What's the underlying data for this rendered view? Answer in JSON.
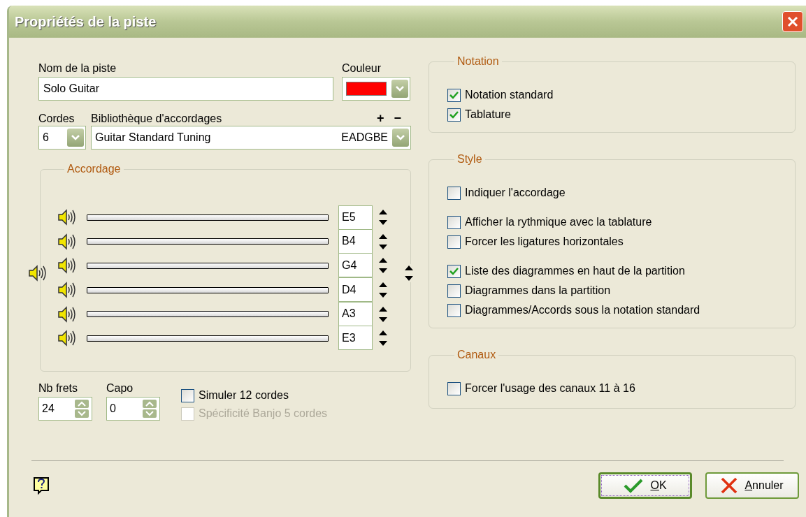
{
  "window": {
    "title": "Propriétés de la piste"
  },
  "track_name": {
    "label": "Nom de la piste",
    "value": "Solo Guitar"
  },
  "track_color": {
    "label": "Couleur",
    "color": "#ff0000"
  },
  "string_count": {
    "label": "Cordes",
    "value": "6"
  },
  "tuning_library": {
    "label": "Bibliothèque d'accordages",
    "add": "+",
    "remove": "−",
    "value": "Guitar Standard Tuning",
    "notes": "EADGBE"
  },
  "tuning": {
    "title": "Accordage",
    "strings": [
      {
        "note": "E5"
      },
      {
        "note": "B4"
      },
      {
        "note": "G4"
      },
      {
        "note": "D4"
      },
      {
        "note": "A3"
      },
      {
        "note": "E3"
      }
    ]
  },
  "frets": {
    "label": "Nb frets",
    "value": "24"
  },
  "capo": {
    "label": "Capo",
    "value": "0"
  },
  "options": [
    {
      "label": "Simuler 12 cordes",
      "checked": false,
      "disabled": false
    },
    {
      "label": "Spécificité Banjo 5 cordes",
      "checked": false,
      "disabled": true
    }
  ],
  "groups": [
    {
      "title": "Notation",
      "sections": [
        [
          {
            "label": "Notation standard",
            "checked": true
          },
          {
            "label": "Tablature",
            "checked": true
          }
        ]
      ]
    },
    {
      "title": "Style",
      "sections": [
        [
          {
            "label": "Indiquer l'accordage",
            "checked": false
          }
        ],
        [
          {
            "label": "Afficher la rythmique avec la tablature",
            "checked": false
          },
          {
            "label": "Forcer les ligatures horizontales",
            "checked": false
          }
        ],
        [
          {
            "label": "Liste des diagrammes en haut de la partition",
            "checked": true
          },
          {
            "label": "Diagrammes dans la partition",
            "checked": false
          },
          {
            "label": "Diagrammes/Accords sous la notation standard",
            "checked": false
          }
        ]
      ]
    },
    {
      "title": "Canaux",
      "sections": [
        [
          {
            "label": "Forcer l'usage des canaux 11 à 16",
            "checked": false
          }
        ]
      ]
    }
  ],
  "buttons": [
    {
      "label": "OK",
      "kind": "ok",
      "default": true
    },
    {
      "label": "Annuler",
      "kind": "cancel",
      "default": false
    }
  ]
}
